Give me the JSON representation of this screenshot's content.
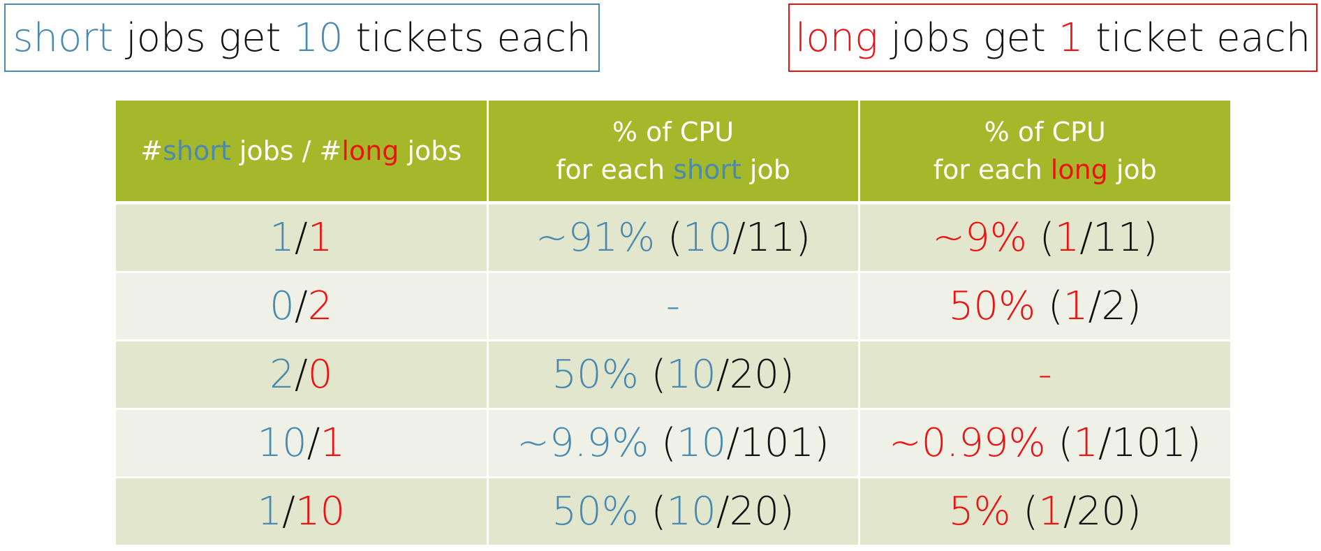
{
  "banners": {
    "short": {
      "word": "short",
      "middle": " jobs get ",
      "count": "10",
      "suffix": " tickets each"
    },
    "long": {
      "word": "long",
      "middle": " jobs get ",
      "count": "1",
      "suffix": " ticket each"
    }
  },
  "table": {
    "header": {
      "col1": {
        "hash1": "#",
        "short": "short",
        "mid": " jobs / #",
        "long": "long",
        "end": " jobs"
      },
      "col2": {
        "line1": "% of CPU",
        "pre": "for each ",
        "short": "short",
        "post": " job"
      },
      "col3": {
        "line1": "% of CPU",
        "pre": "for each ",
        "long": "long",
        "post": " job"
      }
    },
    "rows": [
      {
        "ratio": {
          "short": "1",
          "sep": "/",
          "long": "1"
        },
        "short_pct": {
          "value": "~91%",
          "open": " (",
          "num": "10",
          "rest": "/11)"
        },
        "long_pct": {
          "value": "~9%",
          "open": " (",
          "num": "1",
          "rest": "/11)"
        }
      },
      {
        "ratio": {
          "short": "0",
          "sep": "/",
          "long": "2"
        },
        "short_pct": {
          "value": "-",
          "open": "",
          "num": "",
          "rest": ""
        },
        "long_pct": {
          "value": "50%",
          "open": " (",
          "num": "1",
          "rest": "/2)"
        }
      },
      {
        "ratio": {
          "short": "2",
          "sep": "/",
          "long": "0"
        },
        "short_pct": {
          "value": "50%",
          "open": " (",
          "num": "10",
          "rest": "/20)"
        },
        "long_pct": {
          "value": "-",
          "open": "",
          "num": "",
          "rest": ""
        }
      },
      {
        "ratio": {
          "short": "10",
          "sep": "/",
          "long": "1"
        },
        "short_pct": {
          "value": "~9.9%",
          "open": " (",
          "num": "10",
          "rest": "/101)"
        },
        "long_pct": {
          "value": "~0.99%",
          "open": " (",
          "num": "1",
          "rest": "/101)"
        }
      },
      {
        "ratio": {
          "short": "1",
          "sep": "/",
          "long": "10"
        },
        "short_pct": {
          "value": "50%",
          "open": " (",
          "num": "10",
          "rest": "/20)"
        },
        "long_pct": {
          "value": "5%",
          "open": " (",
          "num": "1",
          "rest": "/20)"
        }
      }
    ]
  },
  "colors": {
    "short": "#4a8ab0",
    "long": "#ee1111",
    "header_bg": "#a4b82a",
    "row_odd_bg": "#e2e6cc",
    "row_even_bg": "#eff1e6"
  }
}
